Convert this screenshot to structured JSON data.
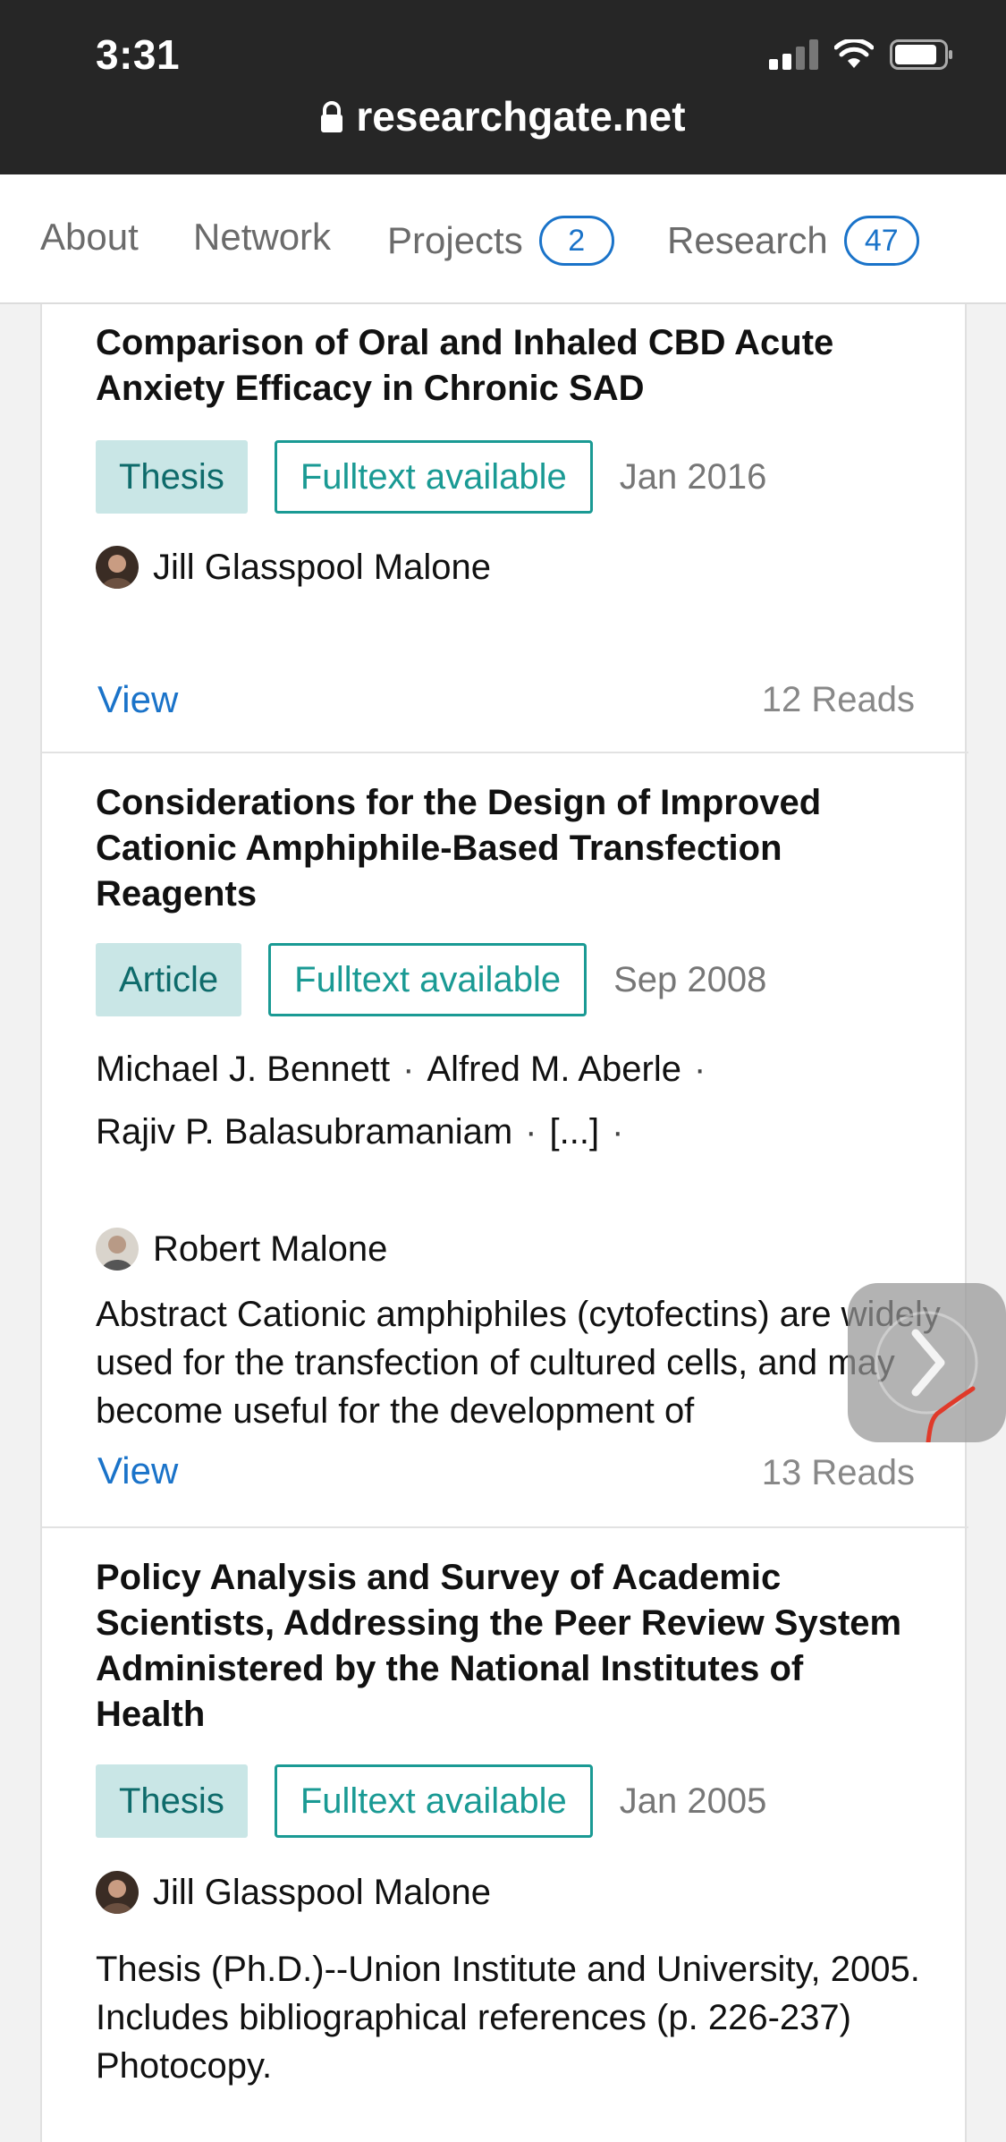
{
  "status": {
    "time": "3:31"
  },
  "browser": {
    "url": "researchgate.net"
  },
  "tabs": [
    {
      "label": "About"
    },
    {
      "label": "Network"
    },
    {
      "label": "Projects",
      "count": "2"
    },
    {
      "label": "Research",
      "count": "47"
    }
  ],
  "items": [
    {
      "title": "Comparison of Oral and Inhaled CBD Acute Anxiety Efficacy in Chronic SAD",
      "type": "Thesis",
      "fulltext": "Fulltext available",
      "date": "Jan 2016",
      "author": "Jill Glasspool Malone",
      "view": "View",
      "reads": "12 Reads"
    },
    {
      "title": "Considerations for the Design of Improved Cationic Amphiphile-Based Transfection Reagents",
      "type": "Article",
      "fulltext": "Fulltext available",
      "date": "Sep 2008",
      "authors": [
        "Michael J. Bennett",
        "Alfred M. Aberle",
        "Rajiv P. Balasubramaniam",
        "[...]"
      ],
      "author": "Robert Malone",
      "abstract": "Abstract Cationic amphiphiles (cytofectins) are widely used for the transfection of cultured cells, and may become useful for the development of",
      "view": "View",
      "reads": "13 Reads"
    },
    {
      "title": "Policy Analysis and Survey of Academic Scientists, Addressing the Peer Review System Administered by the National Institutes of Health",
      "type": "Thesis",
      "fulltext": "Fulltext available",
      "date": "Jan 2005",
      "author": "Jill Glasspool Malone",
      "abstract": "Thesis (Ph.D.)--Union Institute and University, 2005. Includes bibliographical references (p. 226-237) Photocopy."
    }
  ],
  "colors": {
    "accent": "#1a73c9",
    "teal": "#1a9a94",
    "tag_bg": "#c9e6e6"
  }
}
